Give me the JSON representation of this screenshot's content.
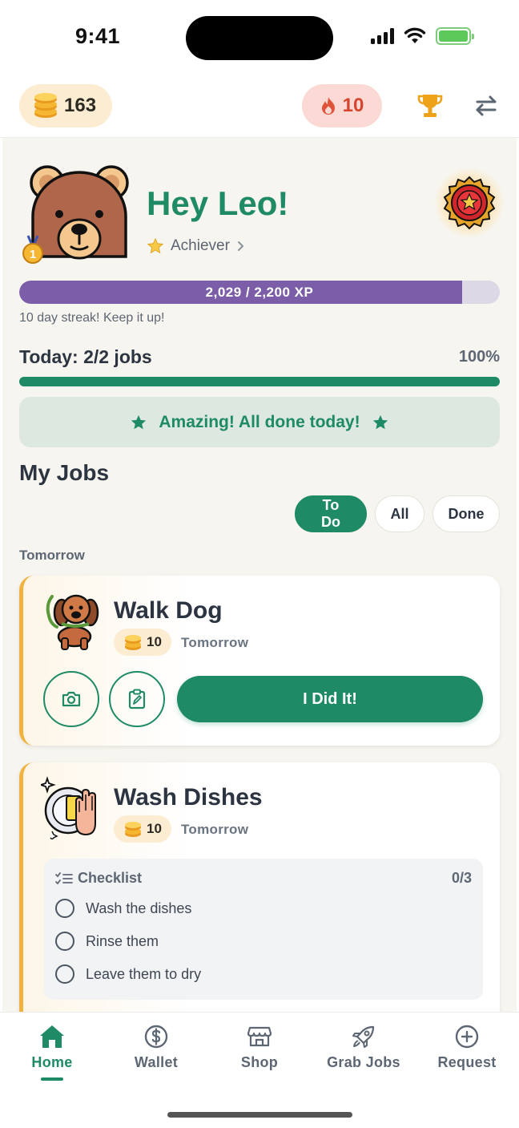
{
  "status_bar": {
    "time": "9:41"
  },
  "top_bar": {
    "coins": "163",
    "streak": "10"
  },
  "profile": {
    "greeting": "Hey Leo!",
    "rank": "Achiever",
    "xp_text": "2,029 / 2,200 XP",
    "xp_progress": 0.922,
    "streak_message": "10 day streak! Keep it up!"
  },
  "today": {
    "label": "Today: 2/2 jobs",
    "percent": "100%",
    "progress": 1.0,
    "banner": "Amazing! All done today!"
  },
  "jobs": {
    "title": "My Jobs",
    "filters": [
      "To Do",
      "All",
      "Done"
    ],
    "active_filter": "To Do",
    "section": "Tomorrow",
    "items": [
      {
        "title": "Walk Dog",
        "reward": "10",
        "due": "Tomorrow",
        "action": "I Did It!"
      },
      {
        "title": "Wash Dishes",
        "reward": "10",
        "due": "Tomorrow",
        "checklist_title": "Checklist",
        "checklist_count": "0/3",
        "checklist": [
          "Wash the dishes",
          "Rinse them",
          "Leave them to dry"
        ]
      }
    ]
  },
  "nav": {
    "items": [
      "Home",
      "Wallet",
      "Shop",
      "Grab Jobs",
      "Request"
    ],
    "active": "Home"
  },
  "colors": {
    "primary": "#1e8a66",
    "xp": "#7b5ea7",
    "accent_orange": "#f0b341",
    "streak_red": "#d5452f"
  }
}
